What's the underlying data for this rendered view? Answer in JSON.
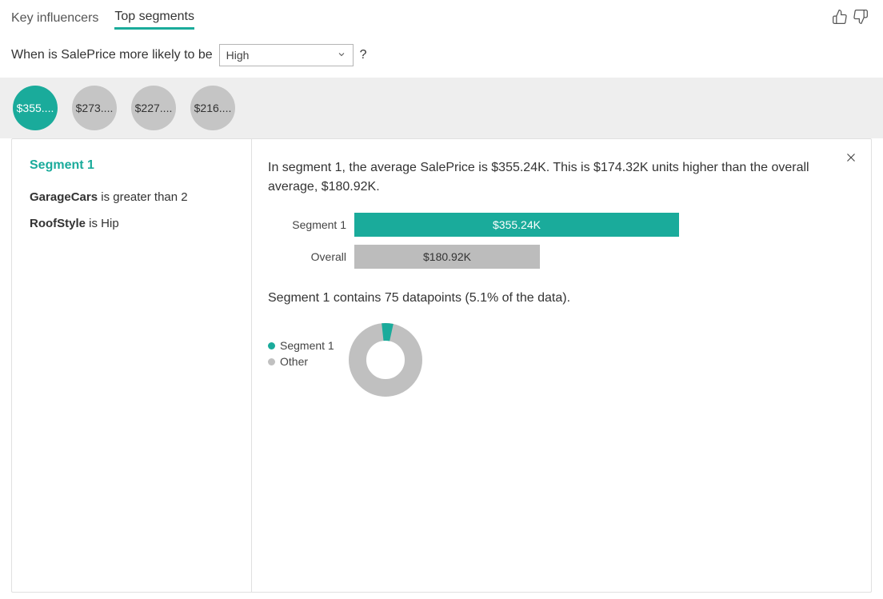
{
  "tabs": {
    "key_influencers": "Key influencers",
    "top_segments": "Top segments"
  },
  "question": {
    "prefix": "When is SalePrice more likely to be",
    "selected": "High",
    "suffix": "?"
  },
  "bubbles": [
    "$355....",
    "$273....",
    "$227....",
    "$216...."
  ],
  "side": {
    "title": "Segment 1",
    "cond1_field": "GarageCars",
    "cond1_text": " is greater than 2",
    "cond2_field": "RoofStyle",
    "cond2_text": " is Hip"
  },
  "main": {
    "summary": "In segment 1, the average SalePrice is $355.24K. This is $174.32K units higher than the overall average, $180.92K.",
    "bar1_label": "Segment 1",
    "bar1_value": "$355.24K",
    "bar2_label": "Overall",
    "bar2_value": "$180.92K",
    "datapoints": "Segment 1 contains 75 datapoints (5.1% of the data).",
    "legend1": "Segment 1",
    "legend2": "Other"
  },
  "chart_data": [
    {
      "type": "bar",
      "title": "Segment 1 vs Overall average SalePrice",
      "orientation": "horizontal",
      "categories": [
        "Segment 1",
        "Overall"
      ],
      "values": [
        355.24,
        180.92
      ],
      "unit": "$K",
      "colors": [
        "#1aab9b",
        "#bcbcbc"
      ]
    },
    {
      "type": "pie",
      "title": "Segment 1 share of data",
      "series": [
        {
          "name": "Segment 1",
          "value": 5.1,
          "color": "#1aab9b"
        },
        {
          "name": "Other",
          "value": 94.9,
          "color": "#c0c0c0"
        }
      ],
      "unit": "%",
      "inner_radius_ratio": 0.55
    }
  ]
}
